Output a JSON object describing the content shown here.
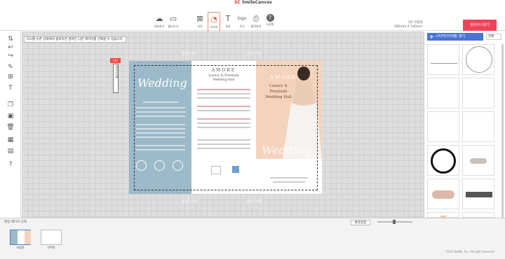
{
  "app": {
    "logo_prefix": "SC",
    "logo_name": "SmileCanvas"
  },
  "toolbar": {
    "buttons": [
      {
        "icon": "upload-icon",
        "label": "저장하기"
      },
      {
        "icon": "folder-icon",
        "label": "불러오기"
      },
      {
        "icon": "photo-icon",
        "label": "사진"
      },
      {
        "icon": "sticker-icon",
        "label": "스티커"
      },
      {
        "icon": "text-icon",
        "label": "글자"
      },
      {
        "icon": "logo-icon",
        "label": "로고"
      },
      {
        "icon": "print-icon",
        "label": "출력하기"
      },
      {
        "icon": "help-icon",
        "label": "도움말"
      }
    ],
    "size_line1": "3단 리플렛",
    "size_line2": "280mm X 180mm",
    "cart_label": "장바구니담기"
  },
  "canvas": {
    "hint": "Ctrl를 누른 상태에서 클릭하면 겹쳐진 다른 레이어를 선택할 수 있습니다.",
    "guide_label": "접히는 부분",
    "ctrl_tag": "Ctrl",
    "ctrl_vert": "레이어선택"
  },
  "doc": {
    "p1_title": "Wedding",
    "p2_brand": "AMORE",
    "p2_sub1": "Luxury & Premium",
    "p2_sub2": "Wedding Hall",
    "p3_brand": "AMORE",
    "p3_sub1": "Luxury & Premium",
    "p3_sub2": "Wedding Hall",
    "p3_script": "Wedding"
  },
  "bottom": {
    "title": "편집 페이지 선택",
    "settings_label": "환경설정",
    "pages": [
      {
        "label": "바깥면"
      },
      {
        "label": "안쪽면"
      }
    ]
  },
  "rightpanel": {
    "tab_label": "스티커(아이템) 찾기",
    "sort_label": "전체"
  },
  "footer": {
    "copyright": "2015 Redth, Inc. All right reserved"
  },
  "colors": {
    "accent": "#f0435a",
    "panel_blue": "#9cbac9",
    "panel_peach": "#f4d3bc",
    "tab_blue": "#4a74d6"
  }
}
